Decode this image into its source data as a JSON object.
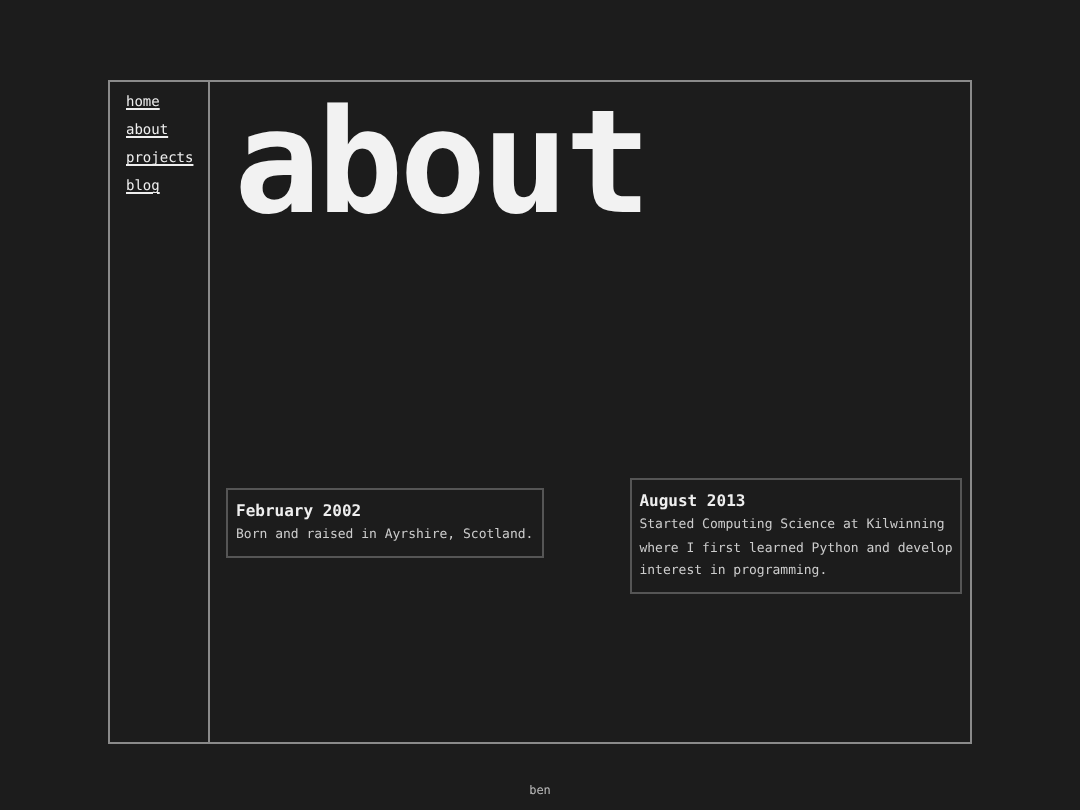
{
  "nav": [
    {
      "label": "home"
    },
    {
      "label": "about"
    },
    {
      "label": "projects"
    },
    {
      "label": "blog"
    }
  ],
  "heading": "about",
  "timeline": [
    {
      "date": "February 2002",
      "text": "Born and raised in Ayrshire, Scotland."
    },
    {
      "date": "August 2013",
      "lines": [
        "Started Computing Science at Kilwinning",
        "where I first learned Python and develop",
        "interest in programming."
      ]
    }
  ],
  "footer": "ben"
}
